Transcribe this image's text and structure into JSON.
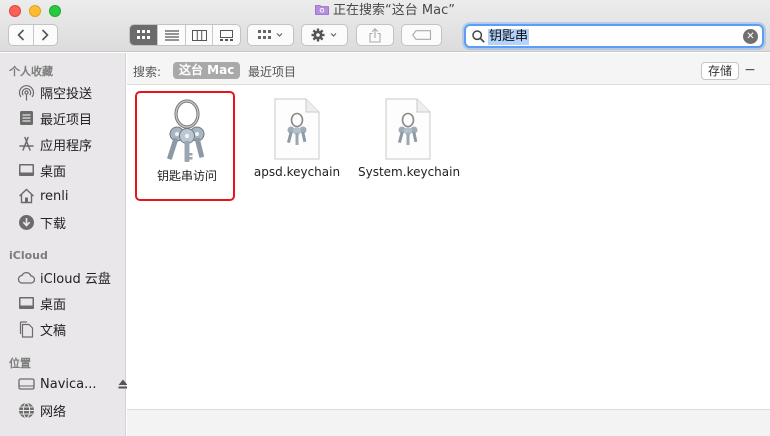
{
  "window": {
    "title": "正在搜索“这台 Mac”"
  },
  "search": {
    "query": "钥匙串",
    "clear_symbol": "✕"
  },
  "sidebar": {
    "sections": [
      {
        "label": "个人收藏",
        "items": [
          {
            "label": "隔空投送",
            "icon": "airdrop-icon"
          },
          {
            "label": "最近项目",
            "icon": "recents-icon"
          },
          {
            "label": "应用程序",
            "icon": "applications-icon"
          },
          {
            "label": "桌面",
            "icon": "desktop-icon"
          },
          {
            "label": "renli",
            "icon": "home-icon"
          },
          {
            "label": "下载",
            "icon": "downloads-icon"
          }
        ]
      },
      {
        "label": "iCloud",
        "items": [
          {
            "label": "iCloud 云盘",
            "icon": "cloud-icon"
          },
          {
            "label": "桌面",
            "icon": "desktop-icon"
          },
          {
            "label": "文稿",
            "icon": "document-icon"
          }
        ]
      },
      {
        "label": "位置",
        "items": [
          {
            "label": "Navica...",
            "icon": "disk-icon"
          },
          {
            "label": "网络",
            "icon": "network-icon"
          }
        ]
      }
    ]
  },
  "scope_bar": {
    "label": "搜索:",
    "active_scope": "这台 Mac",
    "other_scope": "最近项目",
    "save_label": "存储",
    "collapse_symbol": "−"
  },
  "results": [
    {
      "name": "钥匙串访问",
      "kind": "app",
      "selected": true
    },
    {
      "name": "apsd.keychain",
      "kind": "keychain-file",
      "selected": false
    },
    {
      "name": "System.keychain",
      "kind": "keychain-file",
      "selected": false
    }
  ],
  "colors": {
    "selection_outline": "#e8141c",
    "search_focus": "#5d9ef4"
  }
}
